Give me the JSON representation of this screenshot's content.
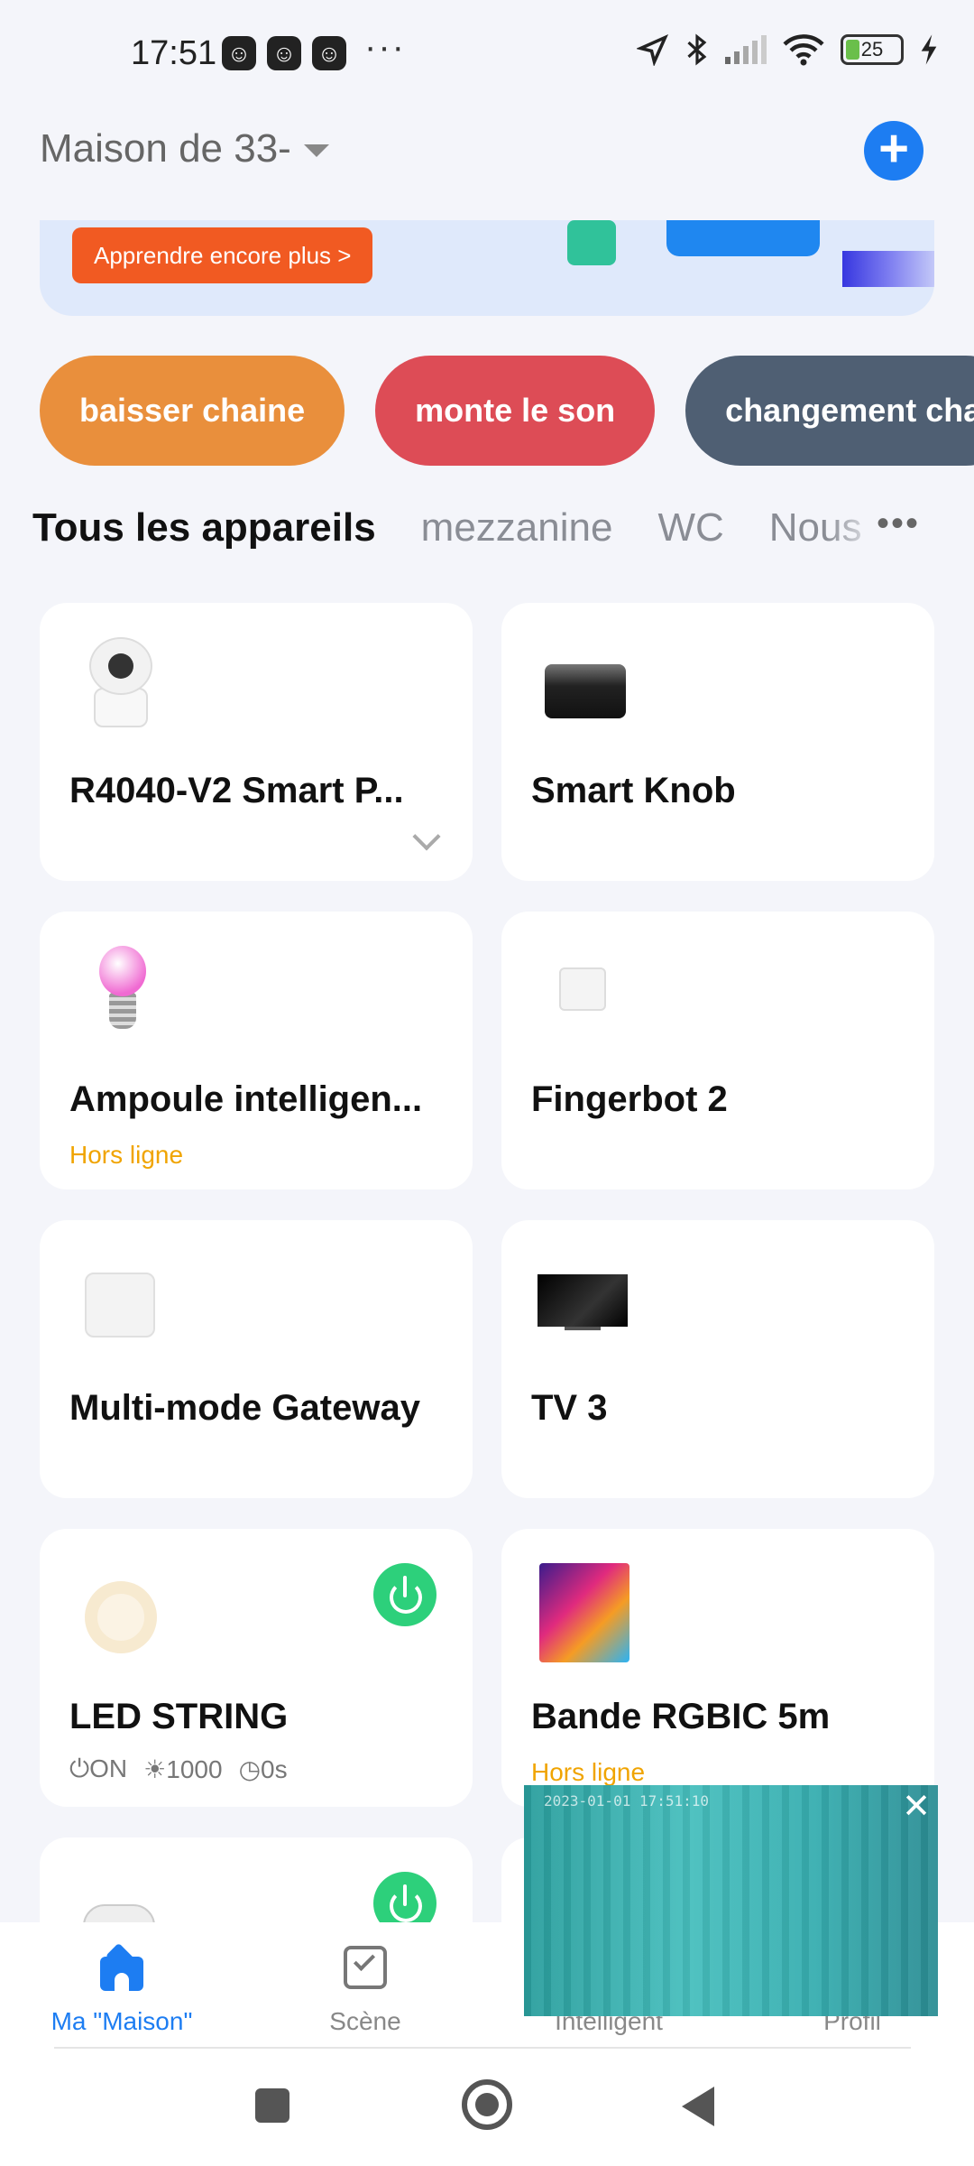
{
  "status_bar": {
    "time": "17:51",
    "dots": "···",
    "battery": "25"
  },
  "header": {
    "home_name": "Maison de 33-",
    "add_label": "+"
  },
  "banner": {
    "button_label": "Apprendre encore plus >"
  },
  "scenes": [
    {
      "label": "baisser chaine",
      "color": "#e98f3c"
    },
    {
      "label": "monte le son",
      "color": "#dd4c56"
    },
    {
      "label": "changement cha",
      "color": "#4f5f73"
    }
  ],
  "tabs": {
    "items": [
      "Tous les appareils",
      "mezzanine",
      "WC",
      "Nous"
    ],
    "more": "•••"
  },
  "devices": [
    {
      "name": "R4040-V2 Smart P...",
      "icon": "camera-icon"
    },
    {
      "name": "Smart Knob",
      "icon": "knob-icon"
    },
    {
      "name": "Ampoule intelligen...",
      "status": "Hors ligne",
      "icon": "bulb-icon"
    },
    {
      "name": "Fingerbot 2",
      "icon": "fingerbot-icon"
    },
    {
      "name": "Multi-mode Gateway",
      "icon": "gateway-icon"
    },
    {
      "name": "TV 3",
      "icon": "tv-icon"
    },
    {
      "name": "LED STRING",
      "icon": "led-ring-icon",
      "meta": {
        "power": "ON",
        "brightness": "1000",
        "timer": "0s"
      }
    },
    {
      "name": "Bande RGBIC 5m",
      "status": "Hors ligne",
      "icon": "rgbic-strip-icon"
    }
  ],
  "camera_overlay": {
    "timestamp": "2023-01-01 17:51:10",
    "close": "✕"
  },
  "bottom_nav": [
    {
      "label": "Ma \"Maison\""
    },
    {
      "label": "Scène"
    },
    {
      "label": "Intelligent"
    },
    {
      "label": "Profil"
    }
  ],
  "colors": {
    "accent": "#1d7df2",
    "offline": "#f0a400",
    "power_on": "#2dd07b"
  }
}
